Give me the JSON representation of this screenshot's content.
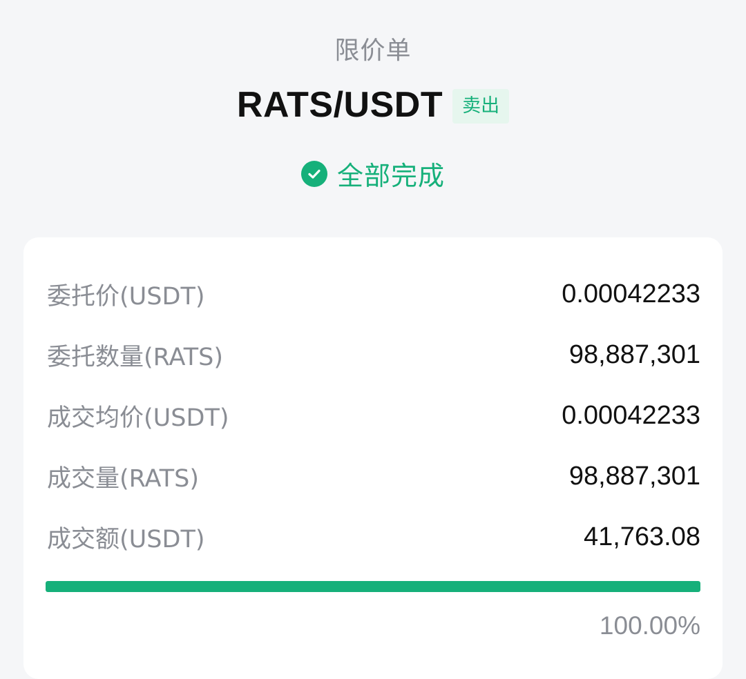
{
  "header": {
    "order_type": "限价单",
    "pair": "RATS/USDT",
    "side": "卖出",
    "status": "全部完成"
  },
  "details": [
    {
      "label": "委托价(USDT)",
      "value": "0.00042233"
    },
    {
      "label": "委托数量(RATS)",
      "value": "98,887,301"
    },
    {
      "label": "成交均价(USDT)",
      "value": "0.00042233"
    },
    {
      "label": "成交量(RATS)",
      "value": "98,887,301"
    },
    {
      "label": "成交额(USDT)",
      "value": "41,763.08"
    }
  ],
  "progress": {
    "percent": 100,
    "text": "100.00%"
  },
  "icons": {
    "status": "check-circle-icon"
  },
  "colors": {
    "accent_green": "#16b07a",
    "badge_bg": "#e6f6ee",
    "muted_text": "#8a8d94"
  }
}
